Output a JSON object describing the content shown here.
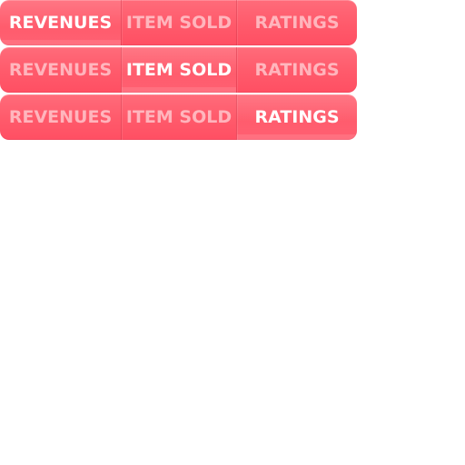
{
  "tabs_sprite": {
    "rows": [
      {
        "active_index": 0,
        "tabs": [
          {
            "label": "REVENUES"
          },
          {
            "label": "ITEM SOLD"
          },
          {
            "label": "RATINGS"
          }
        ]
      },
      {
        "active_index": 1,
        "tabs": [
          {
            "label": "REVENUES"
          },
          {
            "label": "ITEM SOLD"
          },
          {
            "label": "RATINGS"
          }
        ]
      },
      {
        "active_index": 2,
        "tabs": [
          {
            "label": "REVENUES"
          },
          {
            "label": "ITEM SOLD"
          },
          {
            "label": "RATINGS"
          }
        ]
      }
    ]
  },
  "colors": {
    "tab_bg_top": "#ff6b7a",
    "tab_bg_bottom": "#ff4f63",
    "active_text": "#ffffff",
    "inactive_text": "rgba(255,255,255,0.55)"
  }
}
